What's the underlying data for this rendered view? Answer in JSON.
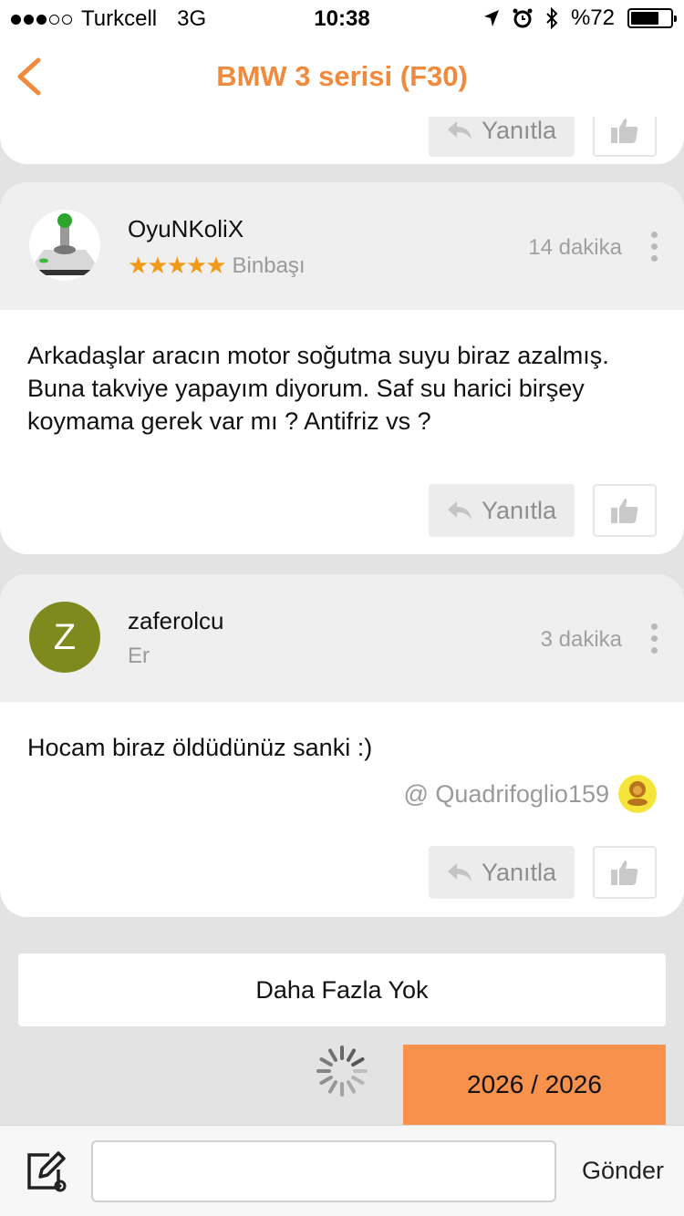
{
  "status_bar": {
    "carrier": "Turkcell",
    "network": "3G",
    "time": "10:38",
    "battery": "%72",
    "battery_level": 0.72
  },
  "nav": {
    "title": "BMW 3 serisi (F30)",
    "back_icon": "chevron-left-icon"
  },
  "reply_label": "Yanıtla",
  "posts": [
    {
      "username": "OyuNKoliX",
      "rank": "Binbaşı",
      "stars": "★★★★★",
      "time": "14 dakika",
      "text": "Arkadaşlar aracın motor soğutma suyu biraz azalmış. Buna takviye yapayım diyorum. Saf su harici birşey koymama gerek var mı ? Antifriz vs ?"
    },
    {
      "username": "zaferolcu",
      "avatar_letter": "Z",
      "rank": "Er",
      "time": "3 dakika",
      "text": "Hocam biraz öldüdünüz sanki :)",
      "mention": "@ Quadrifoglio159"
    }
  ],
  "no_more": "Daha Fazla Yok",
  "pagination": "2026 / 2026",
  "composer": {
    "placeholder": "",
    "send_label": "Gönder"
  },
  "colors": {
    "accent": "#f08a3c",
    "badge": "#f7914b",
    "avatar_z": "#7f8a1e",
    "stars": "#f29a16"
  }
}
